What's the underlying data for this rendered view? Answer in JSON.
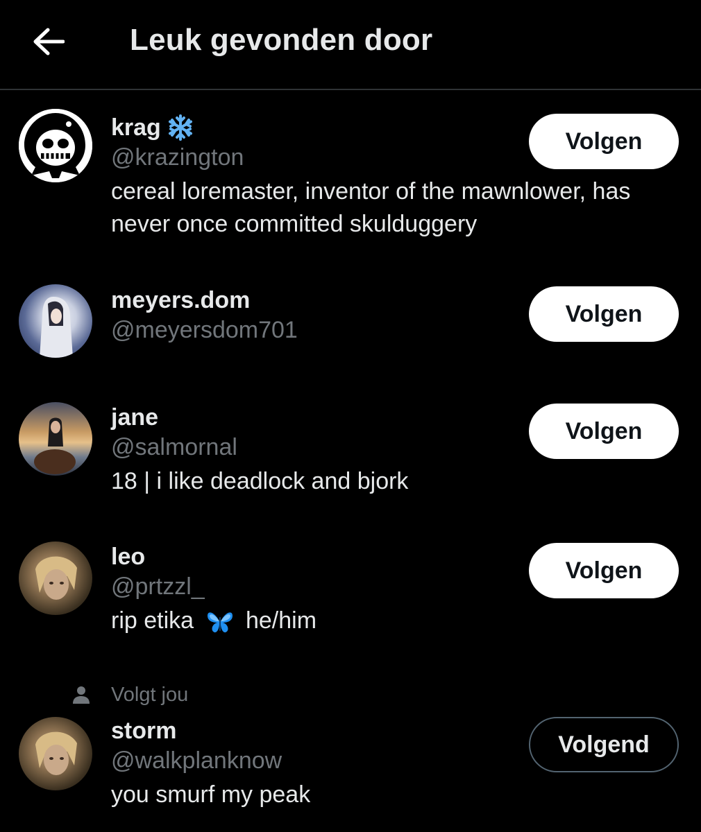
{
  "header": {
    "title": "Leuk gevonden door",
    "back_icon": "arrow-left-icon"
  },
  "colors": {
    "background": "#000000",
    "primary_text": "#e7e9ea",
    "secondary_text": "#71767b",
    "follow_button_bg": "#ffffff",
    "divider": "#2f3336"
  },
  "users": [
    {
      "name": "krag",
      "name_emoji": "snowflake-icon",
      "handle": "@krazington",
      "bio": "cereal loremaster, inventor of the mawnlower, has never once committed skulduggery",
      "button": "Volgen"
    },
    {
      "name": "meyers.dom",
      "handle": "@meyersdom701",
      "button": "Volgen"
    },
    {
      "name": "jane",
      "handle": "@salmornal",
      "bio": "18 | i like deadlock and bjork",
      "button": "Volgen"
    },
    {
      "name": "leo",
      "handle": "@prtzzl_",
      "bio_before": "rip etika",
      "bio_emoji": "butterfly-icon",
      "bio_after": "he/him",
      "button": "Volgen"
    },
    {
      "follows_you": "Volgt jou",
      "name": "storm",
      "handle": "@walkplanknow",
      "bio": "you smurf my peak",
      "button": "Volgend"
    }
  ]
}
